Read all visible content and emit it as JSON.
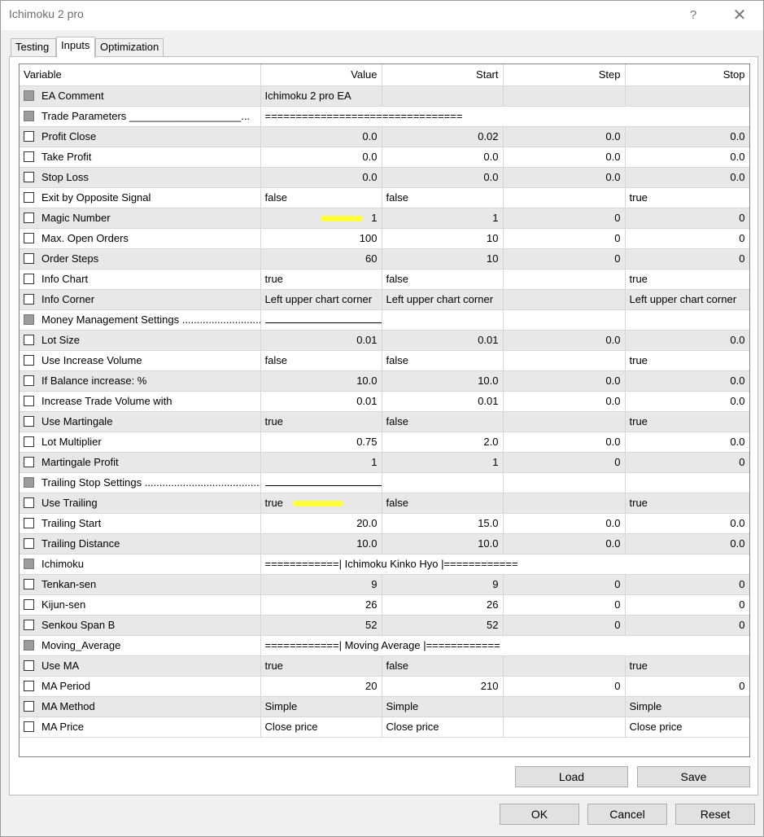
{
  "window": {
    "title": "Ichimoku 2 pro",
    "help": "?",
    "close": "✕"
  },
  "tabs": [
    {
      "label": "Testing"
    },
    {
      "label": "Inputs"
    },
    {
      "label": "Optimization"
    }
  ],
  "columns": [
    "Variable",
    "Value",
    "Start",
    "Step",
    "Stop"
  ],
  "rows": [
    {
      "name": "EA Comment",
      "value": "Ichimoku 2 pro EA",
      "start": "",
      "step": "",
      "stop": ""
    },
    {
      "name": "Trade Parameters ___________________...",
      "value": "================================",
      "start": "",
      "step": "",
      "stop": ""
    },
    {
      "name": "Profit Close",
      "value": "0.0",
      "start": "0.02",
      "step": "0.0",
      "stop": "0.0"
    },
    {
      "name": "Take Profit",
      "value": "0.0",
      "start": "0.0",
      "step": "0.0",
      "stop": "0.0"
    },
    {
      "name": "Stop Loss",
      "value": "0.0",
      "start": "0.0",
      "step": "0.0",
      "stop": "0.0"
    },
    {
      "name": "Exit by Opposite Signal",
      "value": "false",
      "start": "false",
      "step": "",
      "stop": "true"
    },
    {
      "name": "Magic Number",
      "value": "1",
      "start": "1",
      "step": "0",
      "stop": "0"
    },
    {
      "name": "Max. Open Orders",
      "value": "100",
      "start": "10",
      "step": "0",
      "stop": "0"
    },
    {
      "name": "Order Steps",
      "value": "60",
      "start": "10",
      "step": "0",
      "stop": "0"
    },
    {
      "name": "Info Chart",
      "value": "true",
      "start": "false",
      "step": "",
      "stop": "true"
    },
    {
      "name": "Info Corner",
      "value": "Left upper chart corner",
      "start": "Left upper chart corner",
      "step": "",
      "stop": "Left upper chart corner"
    },
    {
      "name": "Money Management Settings ..............................",
      "value": "",
      "start": "",
      "step": "",
      "stop": ""
    },
    {
      "name": "Lot Size",
      "value": "0.01",
      "start": "0.01",
      "step": "0.0",
      "stop": "0.0"
    },
    {
      "name": "Use Increase Volume",
      "value": "false",
      "start": "false",
      "step": "",
      "stop": "true"
    },
    {
      "name": "If Balance increase: %",
      "value": "10.0",
      "start": "10.0",
      "step": "0.0",
      "stop": "0.0"
    },
    {
      "name": "Increase Trade Volume with",
      "value": "0.01",
      "start": "0.01",
      "step": "0.0",
      "stop": "0.0"
    },
    {
      "name": "Use Martingale",
      "value": "true",
      "start": "false",
      "step": "",
      "stop": "true"
    },
    {
      "name": "Lot Multiplier",
      "value": "0.75",
      "start": "2.0",
      "step": "0.0",
      "stop": "0.0"
    },
    {
      "name": "Martingale Profit",
      "value": "1",
      "start": "1",
      "step": "0",
      "stop": "0"
    },
    {
      "name": "Trailing Stop Settings .........................................",
      "value": "",
      "start": "",
      "step": "",
      "stop": ""
    },
    {
      "name": "Use Trailing",
      "value": "true",
      "start": "false",
      "step": "",
      "stop": "true"
    },
    {
      "name": "Trailing Start",
      "value": "20.0",
      "start": "15.0",
      "step": "0.0",
      "stop": "0.0"
    },
    {
      "name": "Trailing Distance",
      "value": "10.0",
      "start": "10.0",
      "step": "0.0",
      "stop": "0.0"
    },
    {
      "name": "Ichimoku",
      "value": "============| Ichimoku Kinko Hyo |============",
      "start": "",
      "step": "",
      "stop": ""
    },
    {
      "name": "Tenkan-sen",
      "value": "9",
      "start": "9",
      "step": "0",
      "stop": "0"
    },
    {
      "name": "Kijun-sen",
      "value": "26",
      "start": "26",
      "step": "0",
      "stop": "0"
    },
    {
      "name": "Senkou Span B",
      "value": "52",
      "start": "52",
      "step": "0",
      "stop": "0"
    },
    {
      "name": "Moving_Average",
      "value": "============| Moving Average |============",
      "start": "",
      "step": "",
      "stop": ""
    },
    {
      "name": "Use MA",
      "value": "true",
      "start": "false",
      "step": "",
      "stop": "true"
    },
    {
      "name": "MA Period",
      "value": "20",
      "start": "210",
      "step": "0",
      "stop": "0"
    },
    {
      "name": "MA Method",
      "value": "Simple",
      "start": "Simple",
      "step": "",
      "stop": "Simple"
    },
    {
      "name": "MA Price",
      "value": "Close price",
      "start": "Close price",
      "step": "",
      "stop": "Close price"
    }
  ],
  "buttons": {
    "load": "Load",
    "save": "Save",
    "ok": "OK",
    "cancel": "Cancel",
    "reset": "Reset"
  },
  "colors": {
    "highlight": "#ffff3a",
    "alt_row": "#e8e8e8"
  }
}
